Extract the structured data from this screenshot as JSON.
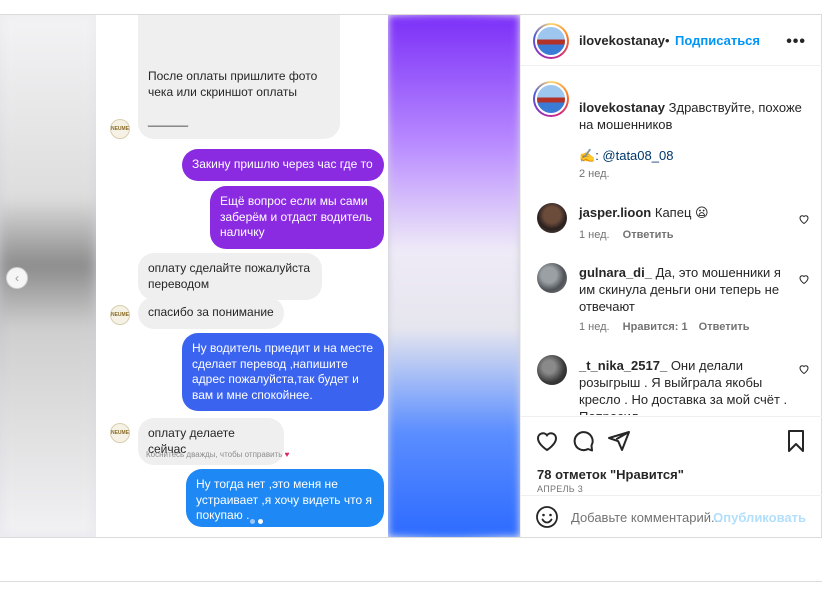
{
  "post": {
    "author": "ilovekostanay",
    "follow_label": "Подписаться",
    "more_label": "•••",
    "separator": "•"
  },
  "media": {
    "prev_arrow": "‹",
    "messages": [
      {
        "dir": "in",
        "text": "После оплаты пришлите фото чека или скриншот оплаты"
      },
      {
        "dir": "in",
        "text": "______"
      },
      {
        "dir": "out",
        "text": "Закину пришлю через час где то"
      },
      {
        "dir": "out",
        "text": "Ещё вопрос если мы сами заберём и отдаст водитель наличку"
      },
      {
        "dir": "in",
        "text": "оплату сделайте пожалуйста переводом"
      },
      {
        "dir": "in",
        "text": "спасибо за понимание"
      },
      {
        "dir": "out",
        "text": "Ну водитель приедит и на месте сделает перевод ,напишите адрес пожалуйста,так будет и вам и мне спокойнее."
      },
      {
        "dir": "in",
        "text": "оплату делаете сейчас"
      },
      {
        "dir": "out",
        "text": "Ну тогда нет ,это меня не устраивает ,я хочу видеть что я покупаю ."
      }
    ],
    "double_tap_hint": "Коснитесь дважды, чтобы отправить",
    "heart": "♥"
  },
  "caption": {
    "username": "ilovekostanay",
    "text": "Здравствуйте, похоже на мошенников",
    "credit_emoji": "✍️",
    "credit_text": ": @tata08_08",
    "time": "2 нед."
  },
  "comments": [
    {
      "username": "jasper.lioon",
      "text": "Капец 😦",
      "time": "1 нед.",
      "reply": "Ответить",
      "likes": ""
    },
    {
      "username": "gulnara_di_",
      "text": "Да, это мошенники я им скинула деньги они теперь не отвечают",
      "time": "1 нед.",
      "likes": "Нравится: 1",
      "reply": "Ответить"
    },
    {
      "username": "_t_nika_2517_",
      "text": "Они делали розыгрыш . Я выйграла якобы кресло . Но доставка за мой счёт . Попросил...",
      "time": "",
      "reply": "",
      "likes": ""
    }
  ],
  "actions": {
    "likes_text": "78 отметок \"Нравится\"",
    "date": "Апрель 3"
  },
  "add_comment": {
    "placeholder": "Добавьте комментарий...",
    "publish": "Опубликовать"
  },
  "colors": {
    "link": "#0095f6",
    "purple_bubble": "#8a2be2",
    "blue_bubble": "#1e88f5"
  }
}
